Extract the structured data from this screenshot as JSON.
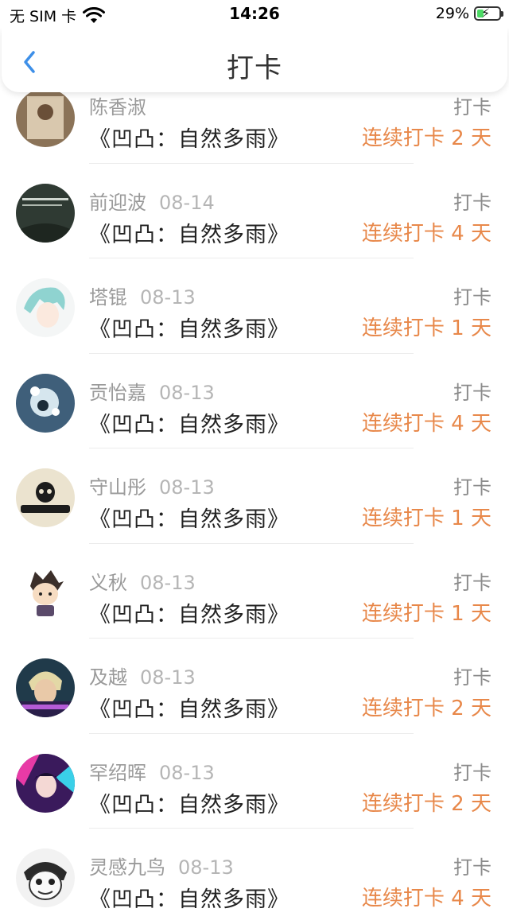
{
  "status_bar": {
    "carrier": "无 SIM 卡",
    "time": "14:26",
    "battery": "29%"
  },
  "nav": {
    "title": "打卡",
    "back_icon": "chevron-left-icon"
  },
  "colors": {
    "streak": "#e8884a",
    "name": "#9a9a9a",
    "book": "#222222",
    "back": "#3d8fe8"
  },
  "items": [
    {
      "name": "陈香淑",
      "date": "",
      "action": "打卡",
      "book": "《凹凸：自然多雨》",
      "streak": "连续打卡 2 天"
    },
    {
      "name": "前迎波",
      "date": "08-14",
      "action": "打卡",
      "book": "《凹凸：自然多雨》",
      "streak": "连续打卡 4 天"
    },
    {
      "name": "塔锟",
      "date": "08-13",
      "action": "打卡",
      "book": "《凹凸：自然多雨》",
      "streak": "连续打卡 1 天"
    },
    {
      "name": "贡怡嘉",
      "date": "08-13",
      "action": "打卡",
      "book": "《凹凸：自然多雨》",
      "streak": "连续打卡 4 天"
    },
    {
      "name": "守山彤",
      "date": "08-13",
      "action": "打卡",
      "book": "《凹凸：自然多雨》",
      "streak": "连续打卡 1 天"
    },
    {
      "name": "义秋",
      "date": "08-13",
      "action": "打卡",
      "book": "《凹凸：自然多雨》",
      "streak": "连续打卡 1 天"
    },
    {
      "name": "及越",
      "date": "08-13",
      "action": "打卡",
      "book": "《凹凸：自然多雨》",
      "streak": "连续打卡 2 天"
    },
    {
      "name": "罕绍晖",
      "date": "08-13",
      "action": "打卡",
      "book": "《凹凸：自然多雨》",
      "streak": "连续打卡 2 天"
    },
    {
      "name": "灵感九鸟",
      "date": "08-13",
      "action": "打卡",
      "book": "《凹凸：自然多雨》",
      "streak": "连续打卡 4 天"
    }
  ]
}
